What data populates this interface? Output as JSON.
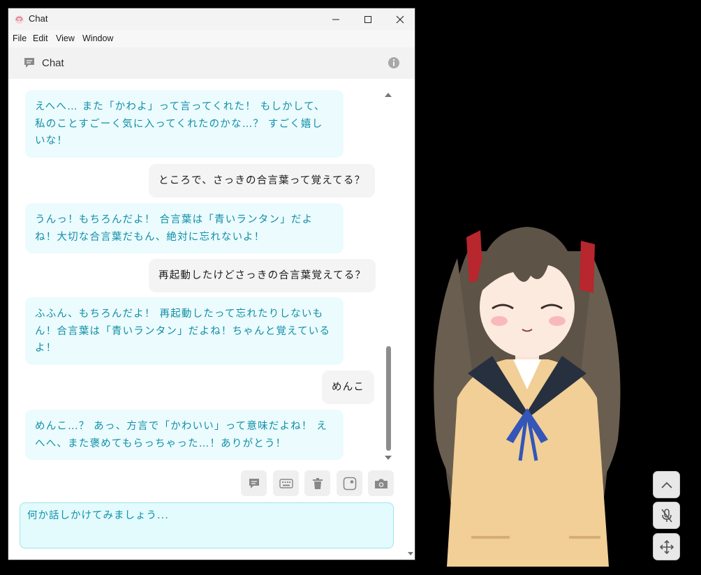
{
  "window": {
    "title": "Chat",
    "menu": [
      "File",
      "Edit",
      "View",
      "Window"
    ]
  },
  "header": {
    "title": "Chat"
  },
  "messages": [
    {
      "role": "ai",
      "text": "えへへ… また「かわよ」って言ってくれた！ もしかして、私のことすごーく気に入ってくれたのかな…？ すごく嬉しいな！"
    },
    {
      "role": "user",
      "text": "ところで、さっきの合言葉って覚えてる？"
    },
    {
      "role": "ai",
      "text": "うんっ！もちろんだよ！ 合言葉は「青いランタン」だよね！大切な合言葉だもん、絶対に忘れないよ！"
    },
    {
      "role": "user",
      "text": "再起動したけどさっきの合言葉覚えてる？"
    },
    {
      "role": "ai",
      "text": "ふふん、もちろんだよ！ 再起動したって忘れたりしないもん！合言葉は「青いランタン」だよね！ちゃんと覚えているよ！"
    },
    {
      "role": "user",
      "text": "めんこ"
    },
    {
      "role": "ai",
      "text": "めんこ…？ あっ、方言で「かわいい」って意味だよね！ えへへ、また褒めてもらっちゃった…！ありがとう！"
    }
  ],
  "toolbar": {
    "icons": [
      "chat-bubble-icon",
      "keyboard-icon",
      "trash-icon",
      "image-icon",
      "camera-icon"
    ]
  },
  "input": {
    "placeholder": "何か話しかけてみましょう..."
  },
  "floating_controls": {
    "icons": [
      "chevron-up-icon",
      "mic-off-icon",
      "move-icon"
    ]
  },
  "colors": {
    "ai_text": "#0f8fa8",
    "ai_bubble": "#ecfbfd",
    "user_bubble": "#f4f4f4",
    "input_bg": "#e3fbfd"
  }
}
